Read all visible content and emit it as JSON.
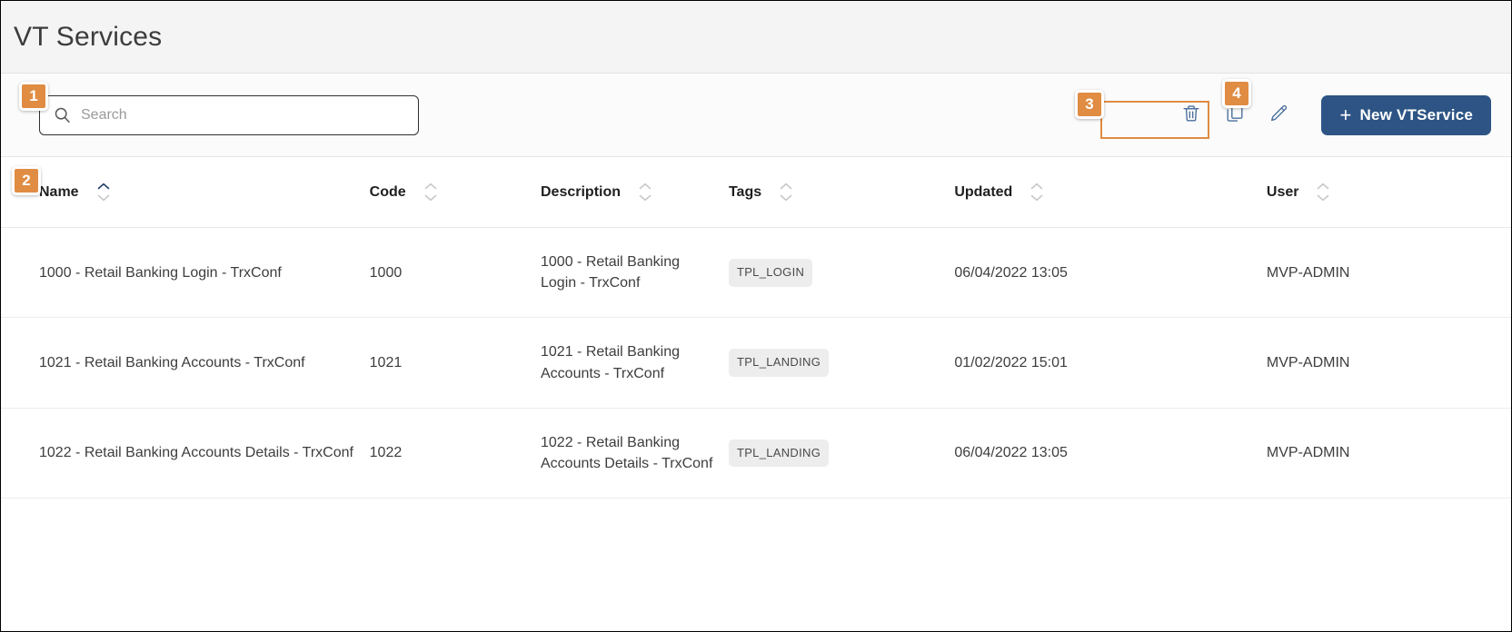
{
  "header": {
    "title": "VT Services"
  },
  "toolbar": {
    "search": {
      "placeholder": "Search",
      "value": "",
      "icon": "search-icon"
    },
    "actions": [
      {
        "name": "delete-button",
        "icon": "trash-icon",
        "label": "Delete"
      },
      {
        "name": "copy-button",
        "icon": "copy-icon",
        "label": "Copy"
      },
      {
        "name": "edit-button",
        "icon": "pencil-icon",
        "label": "Edit"
      }
    ],
    "new_button": {
      "label": "New VTService",
      "plus": "+"
    }
  },
  "table": {
    "columns": [
      {
        "label": "Name",
        "sort": "asc"
      },
      {
        "label": "Code",
        "sort": "none"
      },
      {
        "label": "Description",
        "sort": "none"
      },
      {
        "label": "Tags",
        "sort": "none"
      },
      {
        "label": "Updated",
        "sort": "none"
      },
      {
        "label": "User",
        "sort": "none"
      }
    ],
    "rows": [
      {
        "name": "1000 - Retail Banking Login - TrxConf",
        "code": "1000",
        "description": "1000 - Retail Banking Login - TrxConf",
        "tag": "TPL_LOGIN",
        "updated": "06/04/2022 13:05",
        "user": "MVP-ADMIN"
      },
      {
        "name": "1021 - Retail Banking Accounts - TrxConf",
        "code": "1021",
        "description": "1021 - Retail Banking Accounts - TrxConf",
        "tag": "TPL_LANDING",
        "updated": "01/02/2022 15:01",
        "user": "MVP-ADMIN"
      },
      {
        "name": "1022 - Retail Banking Accounts Details - TrxConf",
        "code": "1022",
        "description": "1022 - Retail Banking Accounts Details - TrxConf",
        "tag": "TPL_LANDING",
        "updated": "06/04/2022 13:05",
        "user": "MVP-ADMIN"
      }
    ]
  },
  "callouts": [
    {
      "number": "1",
      "target": "search-input"
    },
    {
      "number": "2",
      "target": "table-header"
    },
    {
      "number": "3",
      "target": "action-icon-group"
    },
    {
      "number": "4",
      "target": "new-vtservice-button"
    }
  ],
  "colors": {
    "accent_orange": "#e08c43",
    "primary_blue": "#2d5484",
    "icon_blue": "#4a6f9c",
    "header_bg": "#f4f4f4",
    "tag_bg": "#ededed"
  }
}
